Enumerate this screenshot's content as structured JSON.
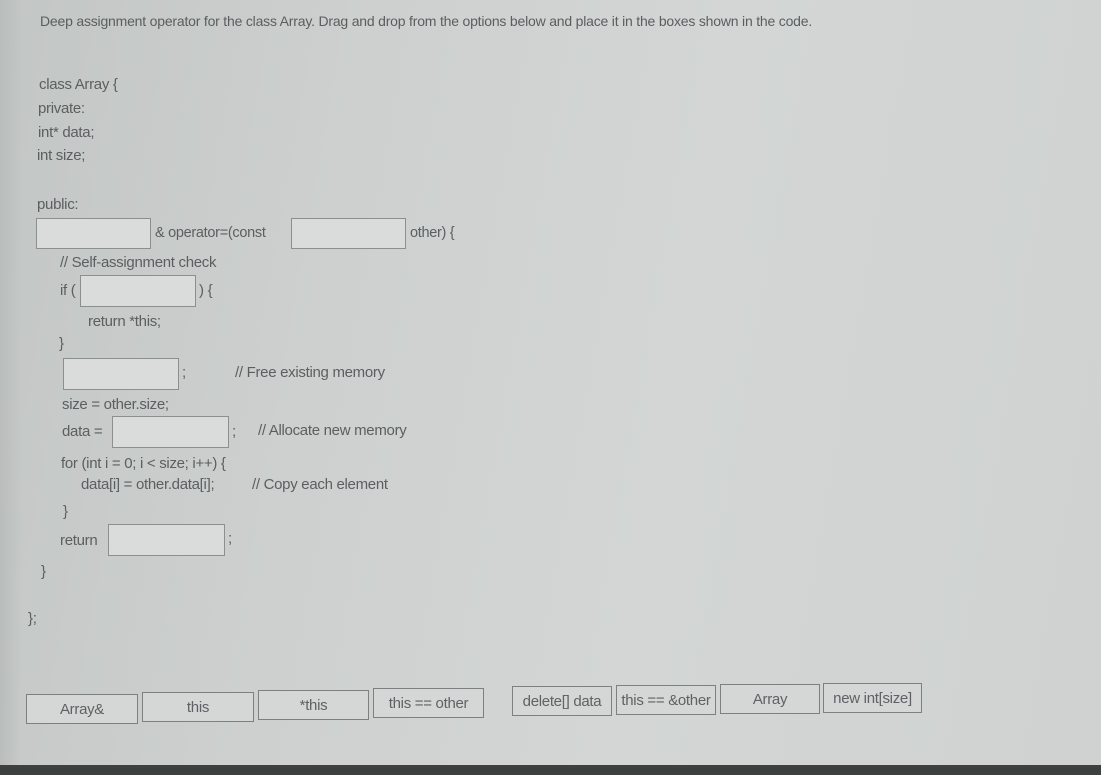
{
  "instruction": "Deep assignment operator for the class Array.  Drag and drop from the options below and place it in the boxes shown in the code.",
  "code": {
    "class_decl": "class Array {",
    "private": "private:",
    "field_data": "int* data;",
    "field_size": "int size;",
    "public": "public:",
    "op_mid": "& operator=(const",
    "op_end": "other) {",
    "self_check_comment": "// Self-assignment check",
    "if_open": "if (",
    "if_close": ") {",
    "return_this": "return *this;",
    "close_brace": "}",
    "semicolon": ";",
    "free_comment": "// Free existing memory",
    "size_assign": "size = other.size;",
    "data_assign": "data =",
    "alloc_comment": "// Allocate new memory",
    "for_loop": "for (int i = 0; i < size; i++) {",
    "copy_line": "data[i] = other.data[i];",
    "copy_comment": "// Copy each element",
    "return_kw": "return",
    "class_end": "};"
  },
  "drop_slots": [
    {
      "id": "return-type",
      "value": ""
    },
    {
      "id": "param-type",
      "value": ""
    },
    {
      "id": "self-check",
      "value": ""
    },
    {
      "id": "free-memory",
      "value": ""
    },
    {
      "id": "allocate",
      "value": ""
    },
    {
      "id": "return-value",
      "value": ""
    }
  ],
  "options": [
    {
      "label": "Array&"
    },
    {
      "label": "this"
    },
    {
      "label": "*this"
    },
    {
      "label": "this == other"
    },
    {
      "label": "delete[] data"
    },
    {
      "label": "this == &other"
    },
    {
      "label": "Array"
    },
    {
      "label": "new int[size]"
    }
  ]
}
